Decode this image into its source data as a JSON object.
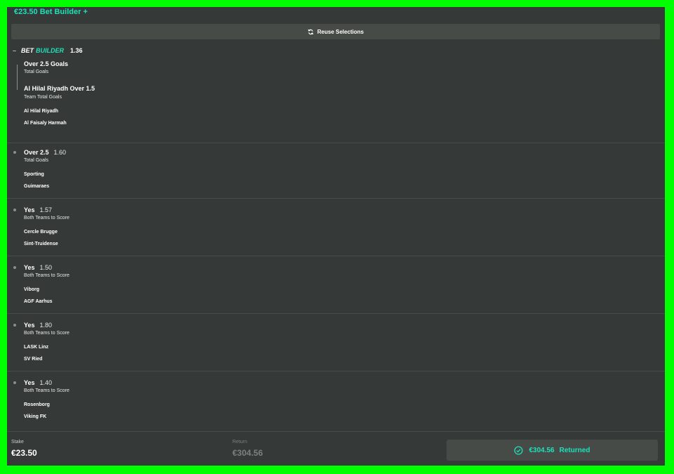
{
  "header": {
    "title": "€23.50 Bet Builder +"
  },
  "reuse": {
    "label": "Reuse Selections",
    "icon": "refresh-icon"
  },
  "bet_builder": {
    "word1": "BET",
    "word2": "BUILDER",
    "odds": "1.36",
    "legs": [
      {
        "name": "Over 2.5 Goals",
        "market": "Total Goals"
      },
      {
        "name": "Al Hilal Riyadh Over 1.5",
        "market": "Team Total Goals"
      }
    ],
    "teams": [
      "Al Hilal Riyadh",
      "Al Faisaly Harmah"
    ]
  },
  "selections": [
    {
      "name": "Over 2.5",
      "odds": "1.60",
      "market": "Total Goals",
      "teams": [
        "Sporting",
        "Guimaraes"
      ]
    },
    {
      "name": "Yes",
      "odds": "1.57",
      "market": "Both Teams to Score",
      "teams": [
        "Cercle Brugge",
        "Sint-Truidense"
      ]
    },
    {
      "name": "Yes",
      "odds": "1.50",
      "market": "Both Teams to Score",
      "teams": [
        "Viborg",
        "AGF Aarhus"
      ]
    },
    {
      "name": "Yes",
      "odds": "1.80",
      "market": "Both Teams to Score",
      "teams": [
        "LASK Linz",
        "SV Ried"
      ]
    },
    {
      "name": "Yes",
      "odds": "1.40",
      "market": "Both Teams to Score",
      "teams": [
        "Rosenborg",
        "Viking FK"
      ]
    }
  ],
  "footer": {
    "stake_label": "Stake",
    "stake_value": "€23.50",
    "return_label": "Return",
    "return_value": "€304.56",
    "returned_amount": "€304.56",
    "returned_label": "Returned"
  },
  "colors": {
    "accent": "#1fe0b8",
    "panel": "#353a38",
    "frame": "#00ff00"
  }
}
